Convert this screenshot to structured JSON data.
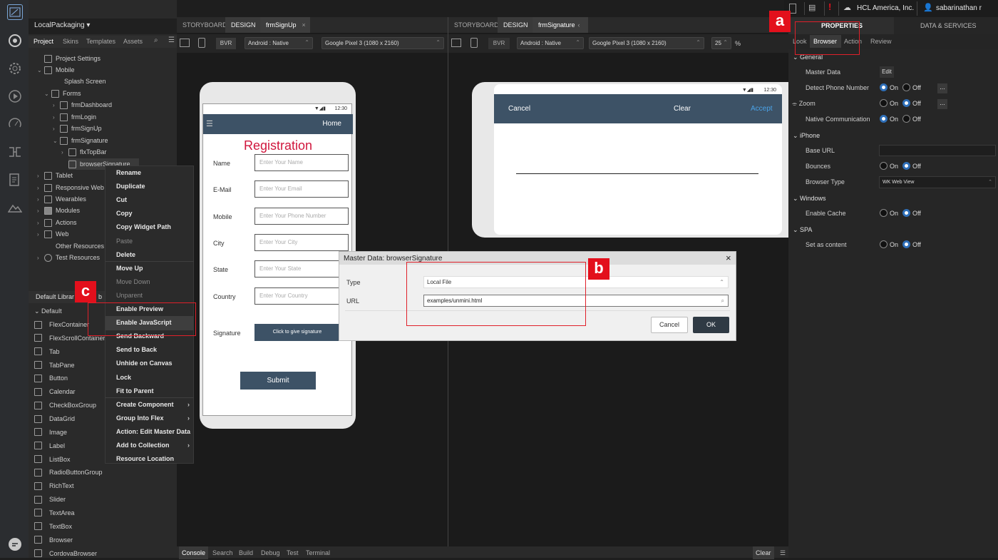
{
  "rail": {
    "icons": [
      "app-logo-icon",
      "network-icon",
      "gear-icon",
      "play-icon",
      "speedometer-icon",
      "flow-icon",
      "document-icon",
      "mountain-icon",
      "chat-icon"
    ]
  },
  "left": {
    "project_name": "LocalPackaging",
    "tabs": [
      "Project",
      "Skins",
      "Templates",
      "Assets"
    ],
    "tree": [
      {
        "label": "Project Settings"
      },
      {
        "label": "Mobile"
      },
      {
        "label": "Splash Screen"
      },
      {
        "label": "Forms"
      },
      {
        "label": "frmDashboard"
      },
      {
        "label": "frmLogin"
      },
      {
        "label": "frmSignUp"
      },
      {
        "label": "frmSignature"
      },
      {
        "label": "flxTopBar"
      },
      {
        "label": "browserSignature"
      },
      {
        "label": "Tablet"
      },
      {
        "label": "Responsive Web"
      },
      {
        "label": "Wearables"
      },
      {
        "label": "Modules"
      },
      {
        "label": "Actions"
      },
      {
        "label": "Web"
      },
      {
        "label": "Other Resources"
      },
      {
        "label": "Test Resources"
      }
    ],
    "library_title": "Default Librar",
    "library_title_tail": "b",
    "library_group": "Default",
    "widgets": [
      "FlexContainer",
      "FlexScrollContainer",
      "Tab",
      "TabPane",
      "Button",
      "Calendar",
      "CheckBoxGroup",
      "DataGrid",
      "Image",
      "Label",
      "ListBox",
      "RadioButtonGroup",
      "RichText",
      "Slider",
      "TextArea",
      "TextBox",
      "Browser",
      "CordovaBrowser"
    ]
  },
  "context_menu": {
    "items": [
      "Rename",
      "Duplicate",
      "Cut",
      "Copy",
      "Copy Widget Path",
      "Paste",
      "Delete",
      "Move Up",
      "Move Down",
      "Unparent",
      "Enable Preview",
      "Enable JavaScript",
      "Send Backward",
      "Send to Back",
      "Unhide on Canvas",
      "Lock",
      "Fit to Parent",
      "Create Component",
      "Group Into Flex",
      "Action: Edit Master Data",
      "Add to Collection",
      "Resource Location"
    ]
  },
  "editor1": {
    "tabs": [
      "STORYBOARD",
      "DESIGN",
      "frmSignUp"
    ],
    "bvr": "BVR",
    "platform": "Android : Native",
    "device": "Google Pixel 3 (1080 x 2160)"
  },
  "editor2": {
    "tabs": [
      "STORYBOARD",
      "DESIGN",
      "frmSignature"
    ],
    "bvr": "BVR",
    "platform": "Android : Native",
    "device": "Google Pixel 3 (1080 x 2160)",
    "zoom": "25",
    "zoom_unit": "%"
  },
  "signup_form": {
    "time": "12:30",
    "home": "Home",
    "title": "Registration",
    "fields": [
      {
        "label": "Name",
        "placeholder": "Enter Your Name"
      },
      {
        "label": "E-Mail",
        "placeholder": "Enter Your Email"
      },
      {
        "label": "Mobile",
        "placeholder": "Enter Your Phone Number"
      },
      {
        "label": "City",
        "placeholder": "Enter Your City"
      },
      {
        "label": "State",
        "placeholder": "Enter Your State"
      },
      {
        "label": "Country",
        "placeholder": "Enter Your Country"
      }
    ],
    "signature_label": "Signature",
    "signature_button": "Click to give signature",
    "submit": "Submit"
  },
  "signature_form": {
    "time": "12:30",
    "cancel": "Cancel",
    "clear": "Clear",
    "accept": "Accept"
  },
  "dialog": {
    "title": "Master Data: browserSignature",
    "type_label": "Type",
    "type_value": "Local File",
    "url_label": "URL",
    "url_value": "examples/unmini.html",
    "cancel": "Cancel",
    "ok": "OK"
  },
  "topbar": {
    "org": "HCL America, Inc.",
    "user": "sabarinathan r",
    "properties": "PROPERTIES",
    "data_services": "DATA & SERVICES"
  },
  "props": {
    "tabs": [
      "Look",
      "Browser",
      "Action",
      "Review"
    ],
    "general": "General",
    "master_data": "Master Data",
    "edit": "Edit",
    "detect_phone": "Detect Phone Number",
    "zoom": "Zoom",
    "native_comm": "Native Communication",
    "iphone": "iPhone",
    "base_url": "Base URL",
    "bounces": "Bounces",
    "browser_type": "Browser Type",
    "browser_type_value": "WK Web View",
    "windows": "Windows",
    "enable_cache": "Enable Cache",
    "spa": "SPA",
    "set_content": "Set as content",
    "on": "On",
    "off": "Off",
    "more": "..."
  },
  "bottom": {
    "tabs": [
      "Console",
      "Search",
      "Build",
      "Debug",
      "Test",
      "Terminal"
    ],
    "clear": "Clear"
  },
  "badges": [
    "a",
    "b",
    "c"
  ],
  "colors": {
    "accent": "#2f6fb8",
    "registration": "#d0163d",
    "header": "#3d5266",
    "annotation": "#e3101c"
  }
}
